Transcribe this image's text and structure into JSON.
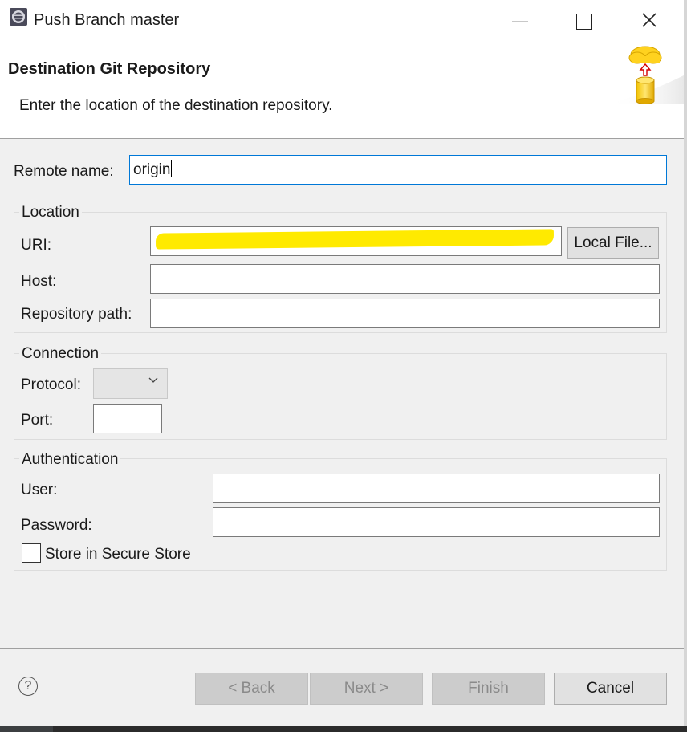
{
  "window": {
    "title": "Push Branch master",
    "close_glyph": "✕"
  },
  "header": {
    "title": "Destination Git Repository",
    "description": "Enter the location of the destination repository.",
    "image_icon": "cloud-upload-database-icon"
  },
  "form": {
    "remote_name_label": "Remote name:",
    "remote_name_value": "origin",
    "location": {
      "title": "Location",
      "uri_label": "URI:",
      "uri_value": "",
      "local_file_label": "Local File...",
      "host_label": "Host:",
      "host_value": "",
      "repo_path_label": "Repository path:",
      "repo_path_value": ""
    },
    "connection": {
      "title": "Connection",
      "protocol_label": "Protocol:",
      "protocol_value": "",
      "port_label": "Port:",
      "port_value": ""
    },
    "authentication": {
      "title": "Authentication",
      "user_label": "User:",
      "user_value": "",
      "password_label": "Password:",
      "password_value": "",
      "store_label": "Store in Secure Store",
      "store_checked": false
    }
  },
  "footer": {
    "help_glyph": "?",
    "back_label": "< Back",
    "next_label": "Next >",
    "finish_label": "Finish",
    "cancel_label": "Cancel"
  },
  "colors": {
    "focus_border": "#0078d7",
    "redaction": "#ffea00",
    "body_bg": "#f0f0f0"
  }
}
